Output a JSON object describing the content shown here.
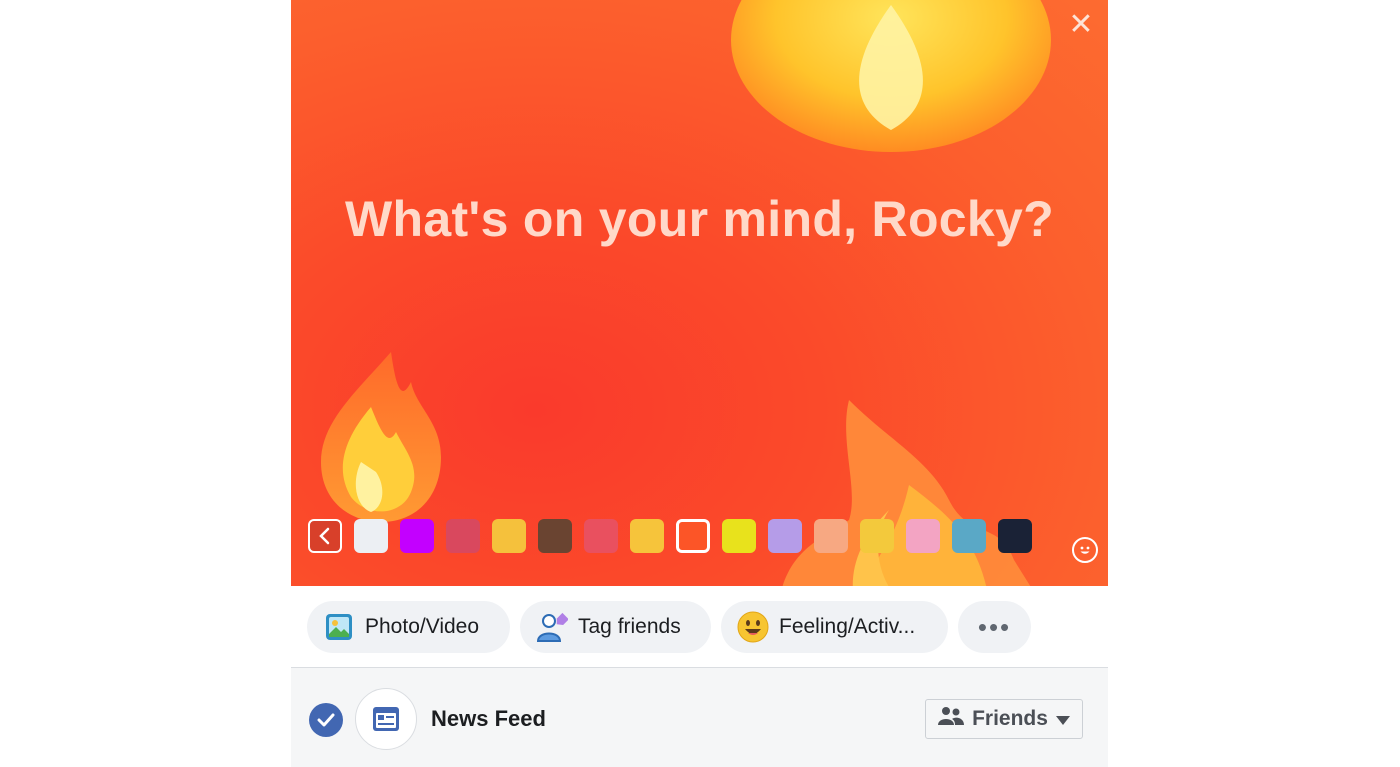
{
  "composer": {
    "prompt": "What's on your mind, Rocky?",
    "close_icon": "close-icon",
    "backgrounds": [
      {
        "name": "white",
        "color": "#eceff3"
      },
      {
        "name": "purple",
        "color": "#c300ff"
      },
      {
        "name": "abstract-pattern",
        "color": "#d9485e"
      },
      {
        "name": "yellow-sticker",
        "color": "#f5c13c"
      },
      {
        "name": "brown",
        "color": "#6a4431"
      },
      {
        "name": "pink-hearts",
        "color": "#e9505f"
      },
      {
        "name": "yellow-sticker-2",
        "color": "#f6c43b"
      },
      {
        "name": "fire-selected",
        "color": "#fc5527"
      },
      {
        "name": "yellow-green",
        "color": "#e8e21c"
      },
      {
        "name": "lavender",
        "color": "#b59ce8"
      },
      {
        "name": "peach-leaves",
        "color": "#f7a882"
      },
      {
        "name": "yellow",
        "color": "#f3c93c"
      },
      {
        "name": "pink-pattern",
        "color": "#f3a4c3"
      },
      {
        "name": "teal-mountain",
        "color": "#5aa8c6"
      },
      {
        "name": "dark-navy",
        "color": "#1a2236"
      }
    ],
    "selected_background": "fire-selected"
  },
  "actions": {
    "photo_video": "Photo/Video",
    "tag_friends": "Tag friends",
    "feeling": "Feeling/Activ...",
    "more": "•••"
  },
  "footer": {
    "feed_label": "News Feed",
    "audience": "Friends"
  },
  "colors": {
    "accent": "#4267b2",
    "canvas": "#fc5527"
  }
}
